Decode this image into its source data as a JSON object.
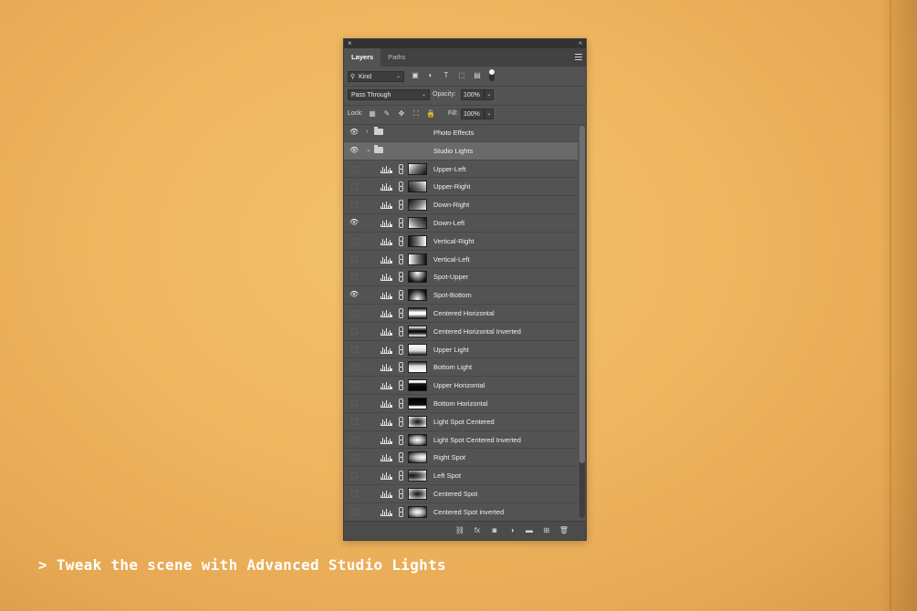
{
  "caption": "> Tweak the scene with Advanced Studio Lights",
  "panel": {
    "tabs": [
      "Layers",
      "Paths"
    ],
    "filter_kind": "Kind",
    "blend_mode": "Pass Through",
    "opacity_label": "Opacity:",
    "opacity_value": "100%",
    "lock_label": "Lock:",
    "fill_label": "Fill:",
    "fill_value": "100%"
  },
  "groups": [
    {
      "name": "Photo Effects",
      "visible": true,
      "expanded": false
    },
    {
      "name": "Studio Lights",
      "visible": true,
      "expanded": true,
      "selected": true
    }
  ],
  "layers": [
    {
      "name": "Upper-Left",
      "visible": false,
      "thumb": "linear-gradient(135deg,#fff 0%,#777 45%,#111 100%)"
    },
    {
      "name": "Upper-Right",
      "visible": false,
      "thumb": "linear-gradient(225deg,#fff 0%,#777 45%,#111 100%)"
    },
    {
      "name": "Down-Right",
      "visible": false,
      "thumb": "linear-gradient(315deg,#fff 0%,#777 45%,#111 100%)"
    },
    {
      "name": "Down-Left",
      "visible": true,
      "thumb": "linear-gradient(45deg,#fff 0%,#777 45%,#111 100%)"
    },
    {
      "name": "Vertical-Right",
      "visible": false,
      "thumb": "linear-gradient(270deg,#fff 0%,#777 50%,#111 100%)"
    },
    {
      "name": "Vertical-Left",
      "visible": false,
      "thumb": "linear-gradient(90deg,#fff 0%,#777 50%,#111 100%)"
    },
    {
      "name": "Spot-Upper",
      "visible": false,
      "thumb": "radial-gradient(ellipse at 50% 10%,#fff 0%,#888 40%,#111 80%)"
    },
    {
      "name": "Spot-Bottom",
      "visible": true,
      "thumb": "radial-gradient(ellipse at 50% 95%,#fff 0%,#888 40%,#111 80%)"
    },
    {
      "name": "Centered Horizontal",
      "visible": false,
      "thumb": "linear-gradient(180deg,#111 0%,#fff 40%,#fff 60%,#111 100%)"
    },
    {
      "name": "Centered Horizontal Inverted",
      "visible": false,
      "thumb": "linear-gradient(180deg,#fff 0%,#111 40%,#111 60%,#fff 100%)"
    },
    {
      "name": "Upper Light",
      "visible": false,
      "thumb": "linear-gradient(180deg,#fff 0%,#ddd 60%,#222 100%)"
    },
    {
      "name": "Bottom Light",
      "visible": false,
      "thumb": "linear-gradient(0deg,#fff 0%,#ddd 60%,#222 100%)"
    },
    {
      "name": "Upper Horizontal",
      "visible": false,
      "thumb": "linear-gradient(180deg,#fff 0%,#fff 20%,#111 35%,#000 100%)"
    },
    {
      "name": "Bottom Horizontal",
      "visible": false,
      "thumb": "linear-gradient(0deg,#fff 0%,#fff 20%,#111 35%,#000 100%)"
    },
    {
      "name": "Light Spot Centered",
      "visible": false,
      "thumb": "radial-gradient(ellipse at 50% 50%,#111 0%,#666 40%,#eee 90%)"
    },
    {
      "name": "Light Spot Centered Inverted",
      "visible": false,
      "thumb": "radial-gradient(ellipse at 50% 50%,#fff 0%,#aaa 45%,#111 95%)"
    },
    {
      "name": "Right Spot",
      "visible": false,
      "thumb": "radial-gradient(ellipse at 80% 50%,#fff 0%,#bbb 40%,#222 90%)"
    },
    {
      "name": "Left Spot",
      "visible": false,
      "thumb": "radial-gradient(ellipse at 20% 50%,#111 0%,#555 40%,#eee 95%)"
    },
    {
      "name": "Centered Spot",
      "visible": false,
      "thumb": "radial-gradient(ellipse at 50% 50%,#111 0%,#555 35%,#ddd 90%)"
    },
    {
      "name": "Centered Spot inverted",
      "visible": false,
      "thumb": "radial-gradient(ellipse at 50% 50%,#fff 0%,#bbb 40%,#222 95%)"
    }
  ],
  "icons": {
    "close": "×",
    "collapse": "«",
    "search": "⚲",
    "chevron": "⌄",
    "eye": "👁",
    "filters": [
      "▣",
      "◐",
      "T",
      "⬚",
      "▤"
    ],
    "locks": [
      "▦",
      "✎",
      "✥",
      "⛶",
      "🔒"
    ],
    "footer": [
      "⛓",
      "fx",
      "◙",
      "◑",
      "▬",
      "⊞",
      "🗑"
    ]
  }
}
